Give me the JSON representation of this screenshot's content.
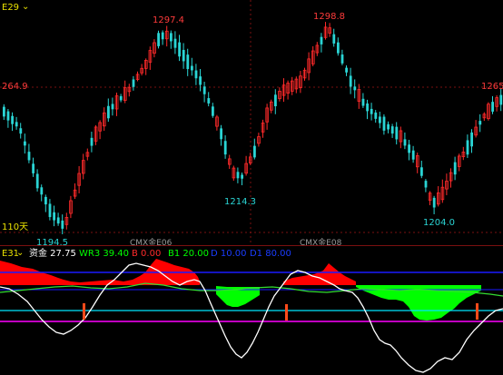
{
  "top_panel": {
    "indicator_name": "E29",
    "chevron_glyph": "⌄",
    "period_label": "110天",
    "price_labels": [
      {
        "text": "1297.4",
        "color": "#ff3b3b"
      },
      {
        "text": "1298.8",
        "color": "#ff3b3b"
      },
      {
        "text": "264.9",
        "color": "#ff3b3b"
      },
      {
        "text": "1265.",
        "color": "#ff3b3b"
      },
      {
        "text": "1214.3",
        "color": "#2ad4d4"
      },
      {
        "text": "1204.0",
        "color": "#2ad4d4"
      },
      {
        "text": "1194.5",
        "color": "#2ad4d4"
      }
    ],
    "contract_labels": [
      "CMX金E06",
      "CMX金E08"
    ]
  },
  "bottom_panel": {
    "indicator_name": "E31",
    "chevron_glyph": "⌄",
    "readouts": [
      {
        "text": "资金 27.75",
        "color": "#ffffff"
      },
      {
        "text": "WR3 39.40",
        "color": "#00ff00"
      },
      {
        "text": "B 0.00",
        "color": "#ff2a2a"
      },
      {
        "text": "B1 20.00",
        "color": "#00ff00"
      },
      {
        "text": "D 10.00",
        "color": "#1a3cff"
      },
      {
        "text": "D1 80.00",
        "color": "#1a3cff"
      }
    ]
  },
  "colors": {
    "up_candle": "#ff2a2a",
    "down_candle": "#2ad4d4",
    "grid": "#7a1010",
    "fill_red": "#ff0000",
    "fill_green": "#00ff00",
    "line_white": "#ffffff",
    "line_blue": "#1a1aff",
    "line_cyan": "#00e5ff",
    "line_magenta": "#ff00ff",
    "line_green": "#33dd33"
  }
}
